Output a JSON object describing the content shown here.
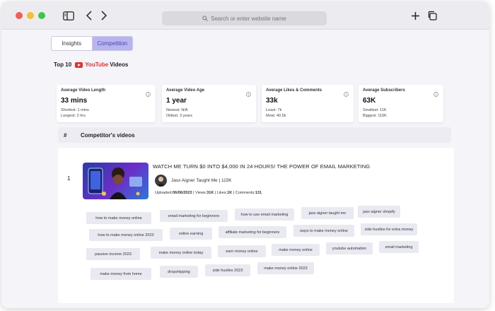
{
  "browser": {
    "address_placeholder": "Search or enter website name"
  },
  "toggle": {
    "insights_label": "Insights",
    "competition_label": "Competition"
  },
  "heading": {
    "prefix": "Top 10",
    "brand": "YouTube",
    "suffix": "Videos"
  },
  "stats_cards": [
    {
      "title": "Average Video Length",
      "value": "33 mins",
      "line1": "Shortest: 1 mins",
      "line2": "Longest: 2 hrs"
    },
    {
      "title": "Average Video Age",
      "value": "1 year",
      "line1": "Newest: N/A",
      "line2": "Oldest: 3 years"
    },
    {
      "title": "Average Likes & Comments",
      "value": "33k",
      "line1": "Least: 7k",
      "line2": "Most: 40.5k"
    },
    {
      "title": "Average Subscribers",
      "value": "63K",
      "line1": "Smallest: 11K",
      "line2": "Biggest: 115K"
    }
  ],
  "table_header": {
    "hash": "#",
    "title": "Competitor's videos"
  },
  "video": {
    "rank": "1",
    "title": "WATCH ME TURN $0 INTO $4,000 IN 24 HOURS! THE POWER OF EMAIL MARKETING",
    "channel": "Jasx Aigner Taught Me | 115K",
    "uploaded_label": "Uploaded:",
    "uploaded_value": "06/06/2023",
    "views_label": "Views:",
    "views_value": "31K",
    "likes_label": "Likes:",
    "likes_value": "1K",
    "comments_label": "Comments:",
    "comments_value": "131"
  },
  "tags": [
    "how to make money online",
    "email marketing for beginners",
    "how to use email marketing",
    "jasx aigner taught me",
    "jasx aigner shopify",
    "how to make money online 2023",
    "online earning",
    "affiliate marketing for beginners",
    "ways to make money online",
    "side hustles for extra money",
    "passive income 2023",
    "make money online today",
    "earn money online",
    "make money online",
    "youtube automation",
    "email marketing",
    "make money from home",
    "dropshipping",
    "side hustles 2023",
    "make money online 2023"
  ],
  "colors": {
    "accent": "#b7b4f1",
    "youtube_red": "#e03030"
  }
}
